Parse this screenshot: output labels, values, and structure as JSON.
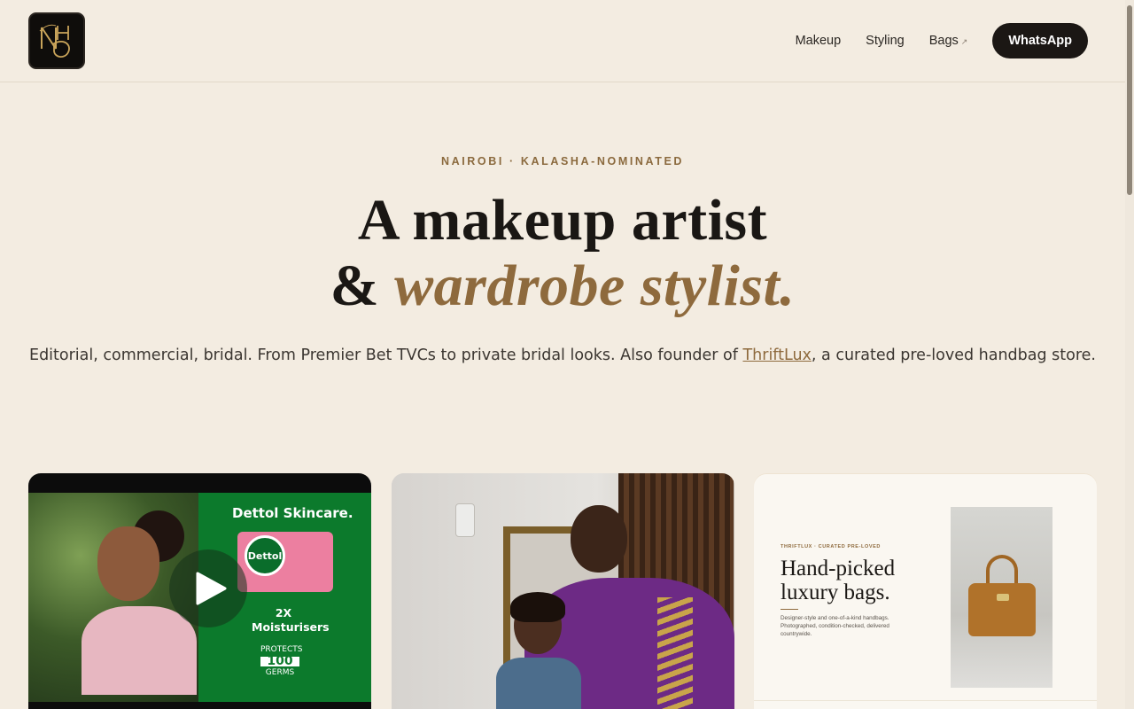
{
  "header": {
    "logo_alt": "NHD monogram",
    "nav": [
      {
        "label": "Makeup"
      },
      {
        "label": "Styling"
      },
      {
        "label": "Bags",
        "ext_icon": "↗"
      }
    ],
    "cta_label": "WhatsApp"
  },
  "hero": {
    "eyebrow": "NAIROBI · KALASHA-NOMINATED",
    "headline_line1": "A makeup artist",
    "headline_amp": "& ",
    "headline_accent": "wardrobe stylist.",
    "lede_part1": "Editorial, commercial, bridal. From Premier Bet TVCs to private bridal looks. Also founder of ",
    "lede_link": "ThriftLux",
    "lede_part2": ", a curated pre-loved handbag store."
  },
  "cards": {
    "video": {
      "brand_text": "Dettol Skincare.",
      "pack_badge": "Dettol",
      "moisturisers": "2X Moisturisers",
      "germs_top": "PROTECTS",
      "germs_number": "100",
      "germs_bottom": "GERMS",
      "play_icon": "play-icon"
    },
    "photo": {},
    "thriftlux": {
      "eyebrow": "THRIFTLUX · CURATED PRE-LOVED",
      "title": "Hand-picked luxury bags.",
      "description": "Designer-style and one-of-a-kind handbags. Photographed, condition-checked, delivered countrywide."
    }
  },
  "colors": {
    "background": "#f3ece1",
    "accent": "#8e6a3d",
    "cta": "#1b1714"
  }
}
